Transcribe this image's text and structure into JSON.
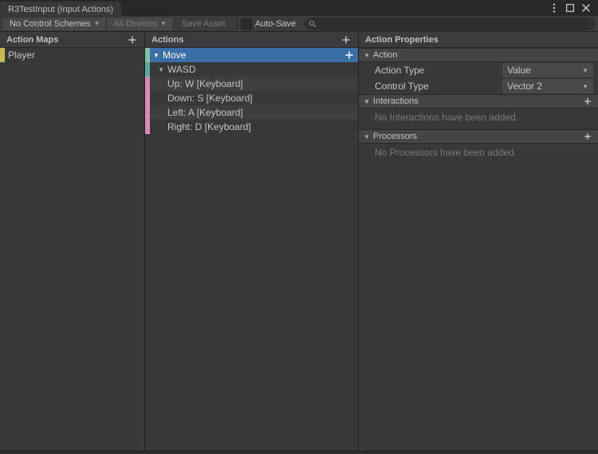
{
  "window": {
    "tab_title": "R3TestInput (Input Actions)"
  },
  "toolbar": {
    "control_schemes": "No Control Schemes",
    "devices": "All Devices",
    "save_asset": "Save Asset",
    "auto_save": "Auto-Save"
  },
  "columns": {
    "maps_header": "Action Maps",
    "actions_header": "Actions",
    "props_header": "Action Properties"
  },
  "action_maps": [
    {
      "label": "Player"
    }
  ],
  "actions": {
    "root": "Move",
    "composite": "WASD",
    "bindings": [
      "Up: W [Keyboard]",
      "Down: S [Keyboard]",
      "Left: A [Keyboard]",
      "Right: D [Keyboard]"
    ]
  },
  "properties": {
    "section_action": "Action",
    "action_type_label": "Action Type",
    "action_type_value": "Value",
    "control_type_label": "Control Type",
    "control_type_value": "Vector 2",
    "section_interactions": "Interactions",
    "interactions_empty": "No Interactions have been added.",
    "section_processors": "Processors",
    "processors_empty": "No Processors have been added."
  }
}
